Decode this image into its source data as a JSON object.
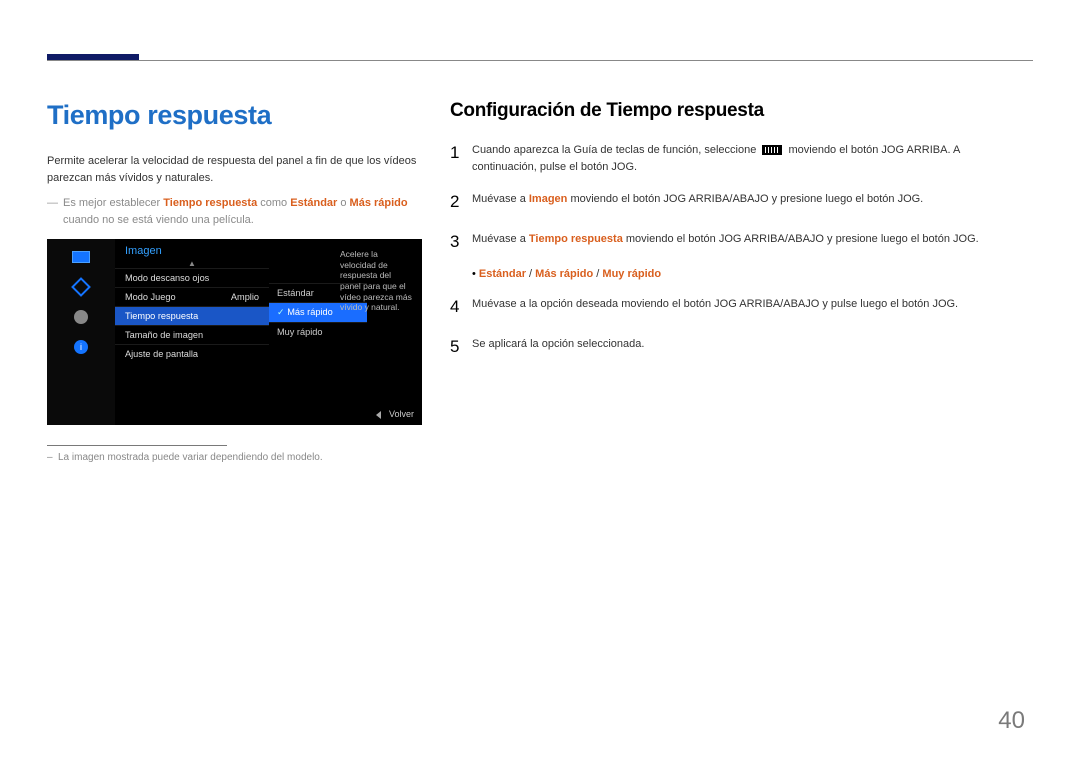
{
  "page_number": "40",
  "left": {
    "heading": "Tiempo respuesta",
    "intro": "Permite acelerar la velocidad de respuesta del panel a fin de que los vídeos parezcan más vívidos y naturales.",
    "note_prefix": "Es mejor establecer ",
    "note_strong1": "Tiempo respuesta",
    "note_mid": " como ",
    "note_strong2": "Estándar",
    "note_or": " o ",
    "note_strong3": "Más rápido",
    "note_suffix": " cuando no se está viendo una película.",
    "disclaimer": "La imagen mostrada puede variar dependiendo del modelo."
  },
  "osd": {
    "title": "Imagen",
    "rows": [
      {
        "label": "Modo descanso ojos",
        "value": ""
      },
      {
        "label": "Modo Juego",
        "value": "Amplio"
      },
      {
        "label": "Tiempo respuesta",
        "value": ""
      },
      {
        "label": "Tamaño de imagen",
        "value": ""
      },
      {
        "label": "Ajuste de pantalla",
        "value": ""
      }
    ],
    "submenu": [
      "Estándar",
      "Más rápido",
      "Muy rápido"
    ],
    "desc": "Acelere la velocidad de respuesta del panel para que el vídeo parezca más vívido y natural.",
    "volver": "Volver",
    "info_glyph": "i"
  },
  "right": {
    "heading": "Configuración de Tiempo respuesta",
    "steps": {
      "s1a": "Cuando aparezca la Guía de teclas de función, seleccione ",
      "s1b": " moviendo el botón JOG ARRIBA. A continuación, pulse el botón JOG.",
      "s2a": "Muévase a ",
      "s2t": "Imagen",
      "s2b": " moviendo el botón JOG ARRIBA/ABAJO y presione luego el botón JOG.",
      "s3a": "Muévase a ",
      "s3t": "Tiempo respuesta",
      "s3b": " moviendo el botón JOG ARRIBA/ABAJO y presione luego el botón JOG.",
      "opt1": "Estándar",
      "sep": " / ",
      "opt2": "Más rápido",
      "opt3": "Muy rápido",
      "s4": "Muévase a la opción deseada moviendo el botón JOG ARRIBA/ABAJO y pulse luego el botón JOG.",
      "s5": "Se aplicará la opción seleccionada."
    },
    "nums": {
      "n1": "1",
      "n2": "2",
      "n3": "3",
      "n4": "4",
      "n5": "5"
    }
  }
}
